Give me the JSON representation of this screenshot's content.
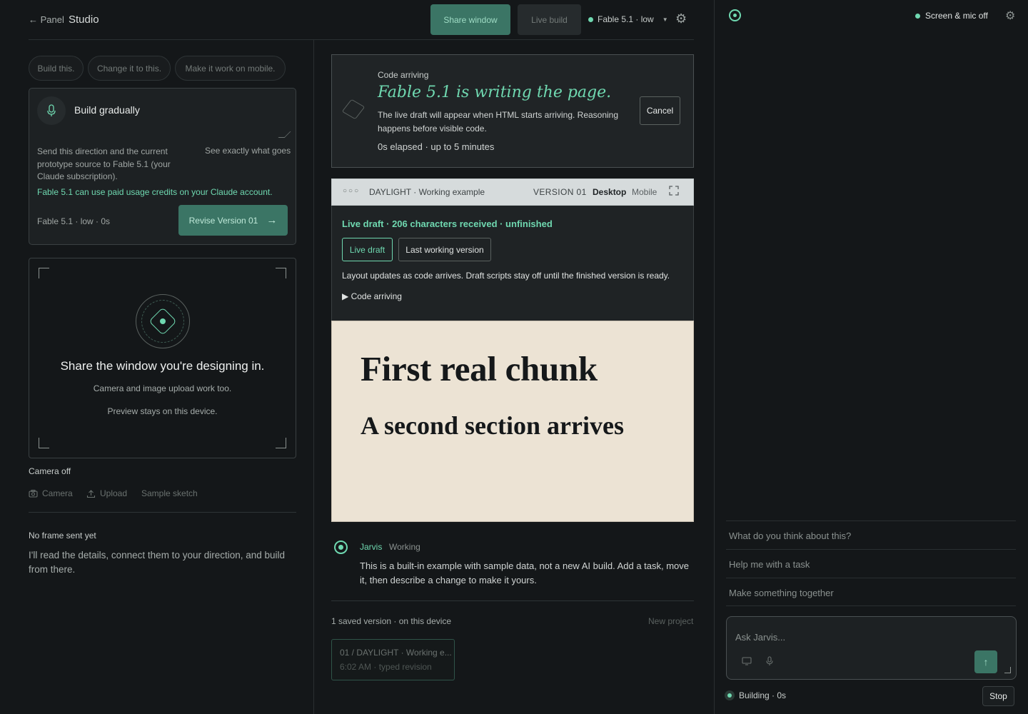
{
  "header": {
    "back_label": "← Panel",
    "title": "Studio",
    "share_label": "Share window",
    "live_build_label": "Live build",
    "model_label": "Fable 5.1 · low"
  },
  "left": {
    "chips": [
      "Build this.",
      "Change it to this.",
      "Make it work on mobile."
    ],
    "direction_text": "Build gradually",
    "send_text": "Send this direction and the current prototype source to Fable 5.1 (your Claude subscription).",
    "see_link": "See exactly what goes",
    "credits_note": "Fable 5.1 can use paid usage credits on your Claude account.",
    "meta": "Fable 5.1 · low · 0s",
    "revise_label": "Revise Version 01",
    "share_title": "Share the window you're designing in.",
    "share_sub1": "Camera and image upload work too.",
    "share_sub2": "Preview stays on this device.",
    "camera_status": "Camera off",
    "tools": [
      "Camera",
      "Upload",
      "Sample sketch"
    ],
    "frame_status": "No frame sent yet",
    "frame_note": "I'll read the details, connect them to your direction, and build from there."
  },
  "center": {
    "code_label": "Code arriving",
    "writing_title": "Fable 5.1 is writing the page.",
    "writing_desc": "The live draft will appear when HTML starts arriving. Reasoning happens before visible code.",
    "elapsed": "0s elapsed · up to 5 minutes",
    "cancel_label": "Cancel",
    "preview": {
      "dots": "○○○",
      "title": "DAYLIGHT · Working example",
      "version": "VERSION 01",
      "desktop": "Desktop",
      "mobile": "Mobile"
    },
    "draft_status": "Live draft · 206 characters received · unfinished",
    "tab_live": "Live draft",
    "tab_last": "Last working version",
    "layout_note": "Layout updates as code arrives. Draft scripts stay off until the finished version is ready.",
    "code_toggle": "▶  Code arriving",
    "page_h1": "First real chunk",
    "page_h2": "A second section arrives",
    "jarvis_name": "Jarvis",
    "jarvis_state": "Working",
    "jarvis_msg": "This is a built-in example with sample data, not a new AI build. Add a task, move it, then describe a change to make it yours.",
    "saved_count": "1 saved version · on this device",
    "new_project": "New project",
    "version_title": "01 / DAYLIGHT · Working e...",
    "version_meta": "6:02 AM · typed revision"
  },
  "right": {
    "screen_mic": "Screen & mic off",
    "suggestions": [
      "What do you think about this?",
      "Help me with a task",
      "Make something together"
    ],
    "ask_placeholder": "Ask Jarvis...",
    "building": "Building · 0s",
    "stop_label": "Stop"
  },
  "colors": {
    "accent": "#6fd8b0",
    "button_fill": "#3b7565",
    "background": "#141719",
    "page_bg": "#ece3d4"
  },
  "icons": [
    "mic-icon",
    "gear-icon",
    "camera-icon",
    "upload-icon",
    "expand-icon",
    "monitor-icon",
    "send-arrow-icon",
    "jarvis-logo-icon"
  ]
}
